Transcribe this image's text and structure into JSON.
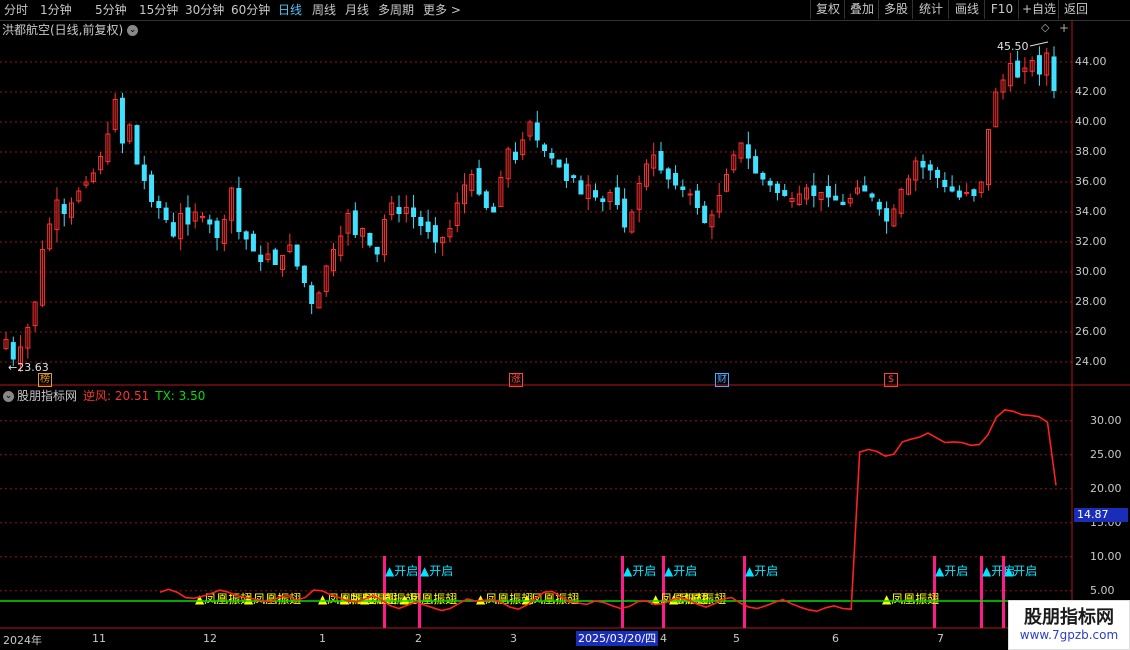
{
  "toolbar": {
    "periods": [
      "分时",
      "1分钟",
      "5分钟",
      "15分钟",
      "30分钟",
      "60分钟",
      "日线",
      "周线",
      "月线",
      "多周期",
      "更多 >"
    ],
    "active_period": "日线",
    "buttons": [
      "复权",
      "叠加",
      "多股",
      "统计",
      "画线",
      "F10",
      "+自选",
      "返回"
    ]
  },
  "stock": {
    "title": "洪都航空(日线,前复权)"
  },
  "price_axis": {
    "ticks": [
      "44.00",
      "42.00",
      "40.00",
      "38.00",
      "36.00",
      "34.00",
      "32.00",
      "30.00",
      "28.00",
      "26.00",
      "24.00"
    ]
  },
  "annotations": {
    "high": "45.50",
    "low": "23.63"
  },
  "event_markers": {
    "items": [
      {
        "label": "榜",
        "color": "#e0a020"
      },
      {
        "label": "涨",
        "color": "#ff4040"
      },
      {
        "label": "财",
        "color": "#4aa8ff"
      },
      {
        "label": "$",
        "color": "#ff4040"
      }
    ]
  },
  "indicator": {
    "title": "股朋指标网",
    "ni_label": "逆风: 20.51",
    "tx_label": "TX: 3.50",
    "axis_ticks": [
      "30.00",
      "25.00",
      "20.00",
      "15.00",
      "10.00",
      "5.00"
    ],
    "current_value": "14.87",
    "kaiqi_label": "▲开启",
    "fenghuang_label": "▲凤凰振翅",
    "colors": {
      "ni": "#ff2020",
      "tx": "#00e000",
      "kaiqi": "#00e5ff",
      "fenghuang": "#ffff00",
      "signal_bar": "#ff1a8c"
    }
  },
  "date_axis": {
    "labels": [
      "2024年",
      "11",
      "12",
      "1",
      "2",
      "3",
      "4",
      "5",
      "6",
      "7"
    ],
    "cursor_date": "2025/03/20/四"
  },
  "watermark": {
    "line1": "股朋指标网",
    "line2": "www.7gpzb.com"
  },
  "chart_data": [
    {
      "type": "candlestick",
      "title": "洪都航空(日线,前复权)",
      "ylim": [
        23,
        45.5
      ],
      "y_ticks": [
        24,
        26,
        28,
        30,
        32,
        34,
        36,
        38,
        40,
        42,
        44
      ],
      "annotations": [
        {
          "text": "45.50",
          "type": "high"
        },
        {
          "text": "23.63",
          "type": "low"
        }
      ],
      "close_path": [
        25.5,
        24.2,
        25.0,
        26.3,
        28.0,
        31.5,
        33.2,
        34.8,
        33.9,
        34.6,
        35.4,
        36.0,
        36.6,
        37.7,
        39.2,
        41.5,
        38.6,
        39.8,
        37.2,
        36.1,
        34.7,
        34.3,
        33.5,
        32.4,
        33.9,
        33.2,
        34.0,
        33.7,
        33.2,
        32.3,
        33.5,
        35.6,
        32.7,
        32.2,
        31.4,
        30.7,
        31.2,
        30.5,
        31.1,
        31.8,
        30.4,
        29.3,
        27.9,
        28.6,
        30.4,
        31.5,
        32.4,
        33.9,
        32.5,
        32.9,
        31.8,
        31.2,
        33.5,
        34.6,
        33.9,
        34.3,
        33.7,
        33.1,
        32.7,
        32.0,
        32.3,
        32.9,
        34.6,
        35.8,
        36.5,
        35.2,
        34.3,
        34.0,
        36.3,
        38.2,
        37.5,
        38.8,
        40.0,
        38.8,
        38.1,
        37.6,
        37.0,
        36.1,
        36.3,
        35.2,
        35.8,
        35.0,
        34.7,
        35.3,
        34.5,
        33.0,
        34.0,
        35.9,
        37.2,
        37.8,
        36.8,
        36.2,
        35.8,
        35.5,
        35.2,
        34.3,
        33.3,
        33.8,
        35.1,
        36.5,
        37.8,
        38.6,
        37.6,
        36.6,
        36.2,
        35.8,
        35.3,
        35.1,
        34.9,
        35.2,
        35.6,
        35.1,
        35.3,
        35.0,
        34.8,
        34.5,
        34.9,
        35.6,
        35.4,
        35.0,
        34.2,
        33.4,
        34.2,
        35.5,
        36.2,
        37.4,
        37.0,
        36.8,
        36.3,
        35.7,
        35.4,
        35.0,
        35.3,
        35.1,
        36.0,
        39.5,
        42.0,
        42.8,
        43.9,
        43.0,
        43.6,
        44.1,
        43.2,
        44.6,
        42.1
      ],
      "series_colors": {
        "up": "#ff3030",
        "down": "#40e0ff"
      }
    },
    {
      "type": "line",
      "series": [
        {
          "name": "逆风",
          "color": "#ff2020",
          "values": [
            4.8,
            5.2,
            4.8,
            4.0,
            3.9,
            4.2,
            4.6,
            5.1,
            4.8,
            4.3,
            4.0,
            3.8,
            3.5,
            3.4,
            4.1,
            4.3,
            3.6,
            4.0,
            5.1,
            5.0,
            4.4,
            4.0,
            3.5,
            3.4,
            3.8,
            4.3,
            3.6,
            2.8,
            2.4,
            2.9,
            3.4,
            2.9,
            2.5,
            2.1,
            2.4,
            3.1,
            3.8,
            3.5,
            3.6,
            3.7,
            3.3,
            2.6,
            2.3,
            2.9,
            3.9,
            4.8,
            4.9,
            4.1,
            3.4,
            3.2,
            3.0,
            3.5,
            3.3,
            2.8,
            2.4,
            2.7,
            3.4,
            3.5,
            3.0,
            3.1,
            3.7,
            4.0,
            3.6,
            3.0,
            2.6,
            3.1,
            3.8,
            4.0,
            3.2,
            2.6,
            2.4,
            2.8,
            3.3,
            3.7,
            3.1,
            2.6,
            2.2,
            2.0,
            2.5,
            2.8,
            2.4,
            2.3,
            25.4,
            25.8,
            25.5,
            24.8,
            25.1,
            26.9,
            27.3,
            27.6,
            28.2,
            27.5,
            26.8,
            26.9,
            26.8,
            26.4,
            26.5,
            27.9,
            30.5,
            31.6,
            31.4,
            30.9,
            30.8,
            30.6,
            29.8,
            20.51
          ]
        },
        {
          "name": "TX",
          "color": "#00e000",
          "values": [
            3.5
          ]
        }
      ],
      "y_ticks": [
        5,
        10,
        15,
        20,
        25,
        30
      ],
      "ylim": [
        0,
        33
      ],
      "signals": [
        {
          "label": "▲开启",
          "count": 10
        },
        {
          "label": "▲凤凰振翅",
          "count": 14
        }
      ]
    }
  ]
}
